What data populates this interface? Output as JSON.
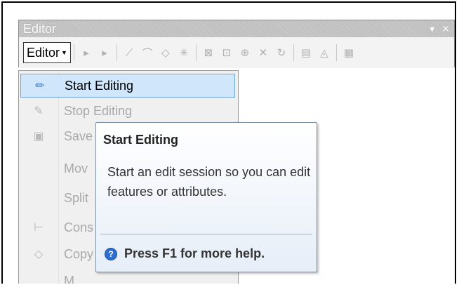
{
  "toolbar": {
    "title": "Editor",
    "menu_button_label": "Editor",
    "title_buttons": [
      "▾",
      "✕"
    ]
  },
  "menu": {
    "items": [
      {
        "label": "Start Editing",
        "icon": "pencil-start-icon",
        "state": "highlighted"
      },
      {
        "label": "Stop Editing",
        "icon": "pencil-stop-icon",
        "state": "disabled"
      },
      {
        "label": "Save",
        "icon": "save-icon",
        "state": "disabled"
      },
      {
        "label": "Mov",
        "icon": "",
        "state": "disabled"
      },
      {
        "label": "Split",
        "icon": "",
        "state": "disabled"
      },
      {
        "label": "Cons",
        "icon": "construct-icon",
        "state": "disabled"
      },
      {
        "label": "Copy",
        "icon": "copy-parallel-icon",
        "state": "disabled"
      },
      {
        "label": "M",
        "icon": "",
        "state": "disabled"
      }
    ]
  },
  "tooltip": {
    "title": "Start Editing",
    "body": "Start an edit session so you can edit features or attributes.",
    "help": "Press F1 for more help."
  },
  "colors": {
    "highlight": "#cfe6fb",
    "highlight_border": "#6fa8dc",
    "disabled_text": "#a9a9a9",
    "help_icon": "#2e6fd1"
  }
}
